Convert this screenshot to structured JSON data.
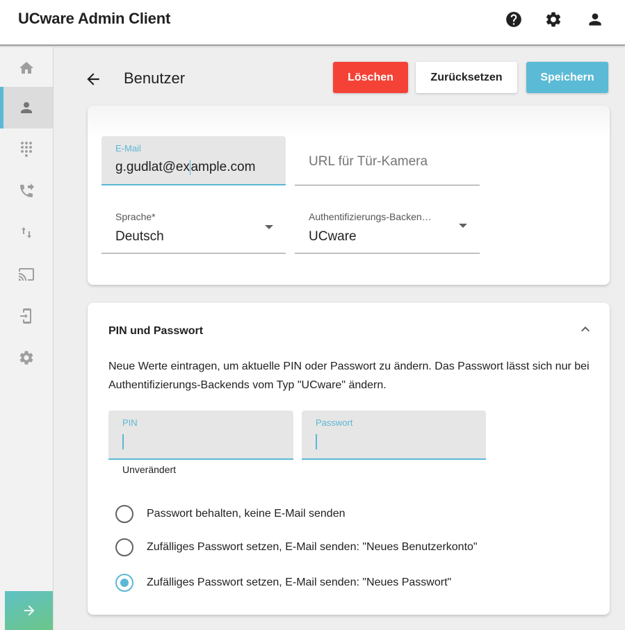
{
  "app": {
    "title": "UCware Admin Client",
    "icons": [
      "help-icon",
      "settings-icon",
      "account-icon"
    ]
  },
  "sidebar": {
    "items": [
      {
        "name": "home",
        "icon": "home-icon",
        "active": false
      },
      {
        "name": "users",
        "icon": "person-icon",
        "active": true
      },
      {
        "name": "dialpad",
        "icon": "dialpad-icon",
        "active": false
      },
      {
        "name": "call-forward",
        "icon": "phone-forward-icon",
        "active": false
      },
      {
        "name": "sort",
        "icon": "arrows-up-down-icon",
        "active": false
      },
      {
        "name": "cast",
        "icon": "cast-icon",
        "active": false
      },
      {
        "name": "provisioning",
        "icon": "device-login-icon",
        "active": false
      },
      {
        "name": "settings",
        "icon": "gear-icon",
        "active": false
      }
    ],
    "expand_icon": "arrow-right-icon"
  },
  "header": {
    "title": "Benutzer",
    "buttons": {
      "delete": "Löschen",
      "reset": "Zurücksetzen",
      "save": "Speichern"
    }
  },
  "user_form": {
    "email": {
      "label": "E-Mail",
      "value": "g.gudlat@example.com"
    },
    "door_camera": {
      "placeholder": "URL für Tür-Kamera"
    },
    "language": {
      "label": "Sprache*",
      "value": "Deutsch"
    },
    "auth_backend": {
      "label": "Authentifizierungs-Backen…",
      "value": "UCware"
    }
  },
  "pin_section": {
    "title": "PIN und Passwort",
    "description": "Neue Werte eintragen, um aktuelle PIN oder Passwort zu ändern. Das Passwort lässt sich nur bei Authentifizierungs-Backends vom Typ \"UCware\" ändern.",
    "pin": {
      "label": "PIN",
      "hint": "Unverändert"
    },
    "password": {
      "label": "Passwort"
    },
    "options": [
      {
        "label": "Passwort behalten, keine E-Mail senden",
        "checked": false
      },
      {
        "label": "Zufälliges Passwort setzen, E-Mail senden: \"Neues Benutzerkonto\"",
        "checked": false
      },
      {
        "label": "Zufälliges Passwort setzen, E-Mail senden: \"Neues Passwort\"",
        "checked": true
      }
    ]
  },
  "colors": {
    "accent": "#5bb8d4",
    "danger": "#f44336",
    "save": "#5bbad5"
  }
}
